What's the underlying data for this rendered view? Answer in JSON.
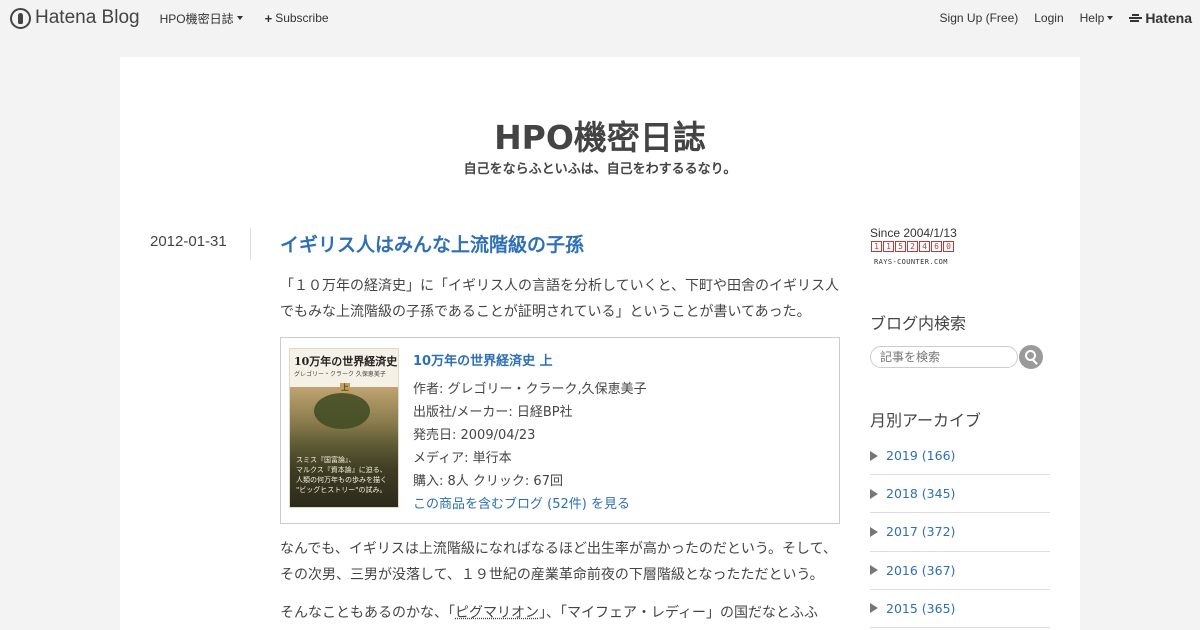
{
  "header": {
    "logo_text": "Hatena Blog",
    "blog_menu_label": "HPO機密日誌",
    "subscribe_label": "Subscribe",
    "signup_label": "Sign Up (Free)",
    "login_label": "Login",
    "help_label": "Help",
    "hatena_label": "Hatena"
  },
  "blog": {
    "title": "HPO機密日誌",
    "description": "自己をならふといふは、自己をわするるなり。"
  },
  "entry": {
    "date": "2012-01-31",
    "title": "イギリス人はみんな上流階級の子孫",
    "paragraph1": "「１０万年の経済史」に「イギリス人の言語を分析していくと、下町や田舎のイギリス人でもみな上流階級の子孫であることが証明されている」ということが書いてあった。",
    "product": {
      "cover_title": "10万年の世界経済史",
      "cover_subtitle": "グレゴリー・クラーク 久保恵美子",
      "cover_volume": "上",
      "cover_blurb": [
        "スミス『国富論』、",
        "マルクス『資本論』に迫る、",
        "人類の何万年もの歩みを描く",
        "\"ビッグヒストリー\"の試み。"
      ],
      "title": "10万年の世界経済史 上",
      "author": "作者: グレゴリー・クラーク,久保恵美子",
      "publisher": "出版社/メーカー: 日経BP社",
      "release": "発売日: 2009/04/23",
      "media": "メディア: 単行本",
      "purchase": "購入: 8人 クリック: 67回",
      "blogs_link": "この商品を含むブログ (52件) を見る"
    },
    "paragraph2": "なんでも、イギリスは上流階級になればなるほど出生率が高かったのだという。そして、その次男、三男が没落して、１９世紀の産業革命前夜の下層階級となったただという。",
    "paragraph3_prefix": "そんなこともあるのかな、「",
    "paragraph3_link1": "ピグマリオン",
    "paragraph3_mid": "」、「マイフェア・レディー」の国だなとふふ"
  },
  "sidebar": {
    "since": "Since 2004/1/13",
    "counter_digits": [
      "1",
      "1",
      "5",
      "2",
      "4",
      "6",
      "0"
    ],
    "counter_caption": "RAYS-COUNTER.COM",
    "search_heading": "ブログ内検索",
    "search_placeholder": "記事を検索",
    "archive_heading": "月別アーカイブ",
    "archive": [
      {
        "label": "2019 (166)"
      },
      {
        "label": "2018 (345)"
      },
      {
        "label": "2017 (372)"
      },
      {
        "label": "2016 (367)"
      },
      {
        "label": "2015 (365)"
      }
    ]
  }
}
